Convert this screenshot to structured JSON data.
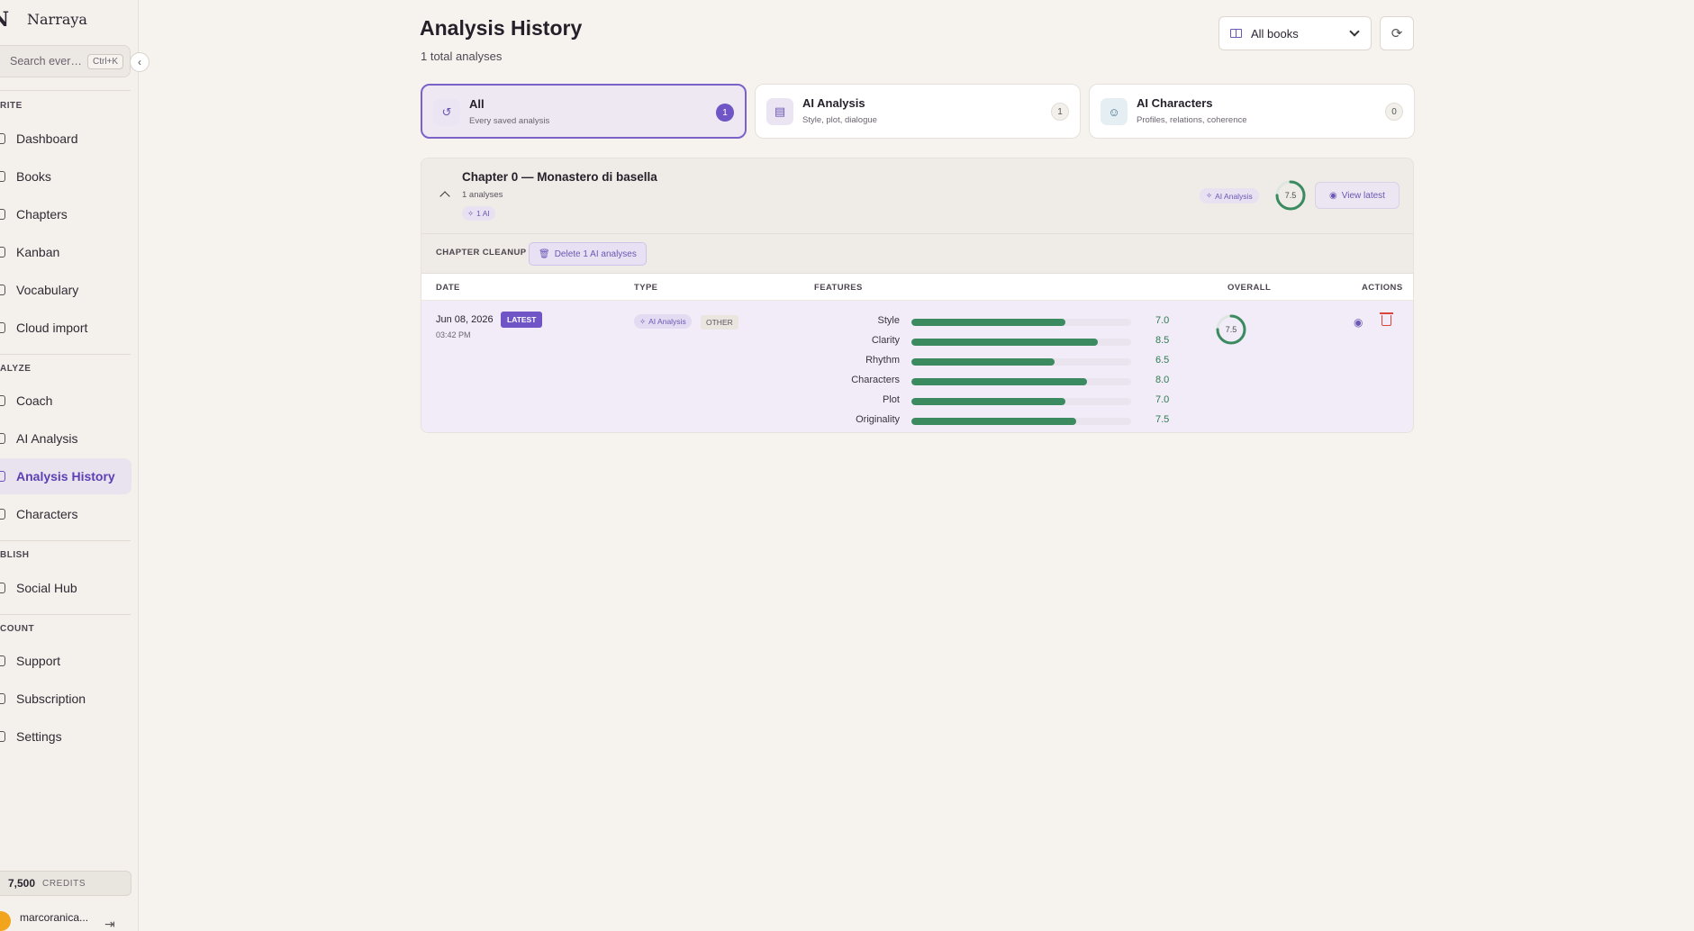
{
  "sidebar": {
    "brand": "Narraya",
    "brand_mark": "N",
    "search_placeholder": "Search ever…",
    "search_shortcut": "Ctrl+K",
    "sections": {
      "write": "RITE",
      "analyze": "ALYZE",
      "publish": "BLISH",
      "account": "COUNT"
    },
    "items": {
      "dashboard": "Dashboard",
      "books": "Books",
      "chapters": "Chapters",
      "kanban": "Kanban",
      "vocabulary": "Vocabulary",
      "cloud_import": "Cloud import",
      "coach": "Coach",
      "ai_analysis": "AI Analysis",
      "analysis_history": "Analysis History",
      "characters": "Characters",
      "social_hub": "Social Hub",
      "support": "Support",
      "subscription": "Subscription",
      "settings": "Settings"
    },
    "credits_value": "7,500",
    "credits_label": "CREDITS",
    "user_name": "marcoranica..."
  },
  "header": {
    "title": "Analysis History",
    "subtitle": "1 total analyses",
    "book_filter": "All books"
  },
  "filters": [
    {
      "title": "All",
      "desc": "Every saved analysis",
      "count": "1"
    },
    {
      "title": "AI Analysis",
      "desc": "Style, plot, dialogue",
      "count": "1"
    },
    {
      "title": "AI Characters",
      "desc": "Profiles, relations, coherence",
      "count": "0"
    }
  ],
  "group": {
    "title": "Chapter 0 — Monastero di basella",
    "count": "1 analyses",
    "ai_pill": "1 AI",
    "type_badge": "AI Analysis",
    "score": "7.5",
    "view_latest": "View latest",
    "cleanup_label": "CHAPTER CLEANUP",
    "delete_label": "Delete 1 AI analyses"
  },
  "table": {
    "headers": {
      "date": "DATE",
      "type": "TYPE",
      "features": "FEATURES",
      "overall": "OVERALL",
      "actions": "ACTIONS"
    },
    "row": {
      "date": "Jun 08, 2026",
      "latest_tag": "LATEST",
      "time": "03:42 PM",
      "type_badge": "AI Analysis",
      "type_other": "OTHER",
      "overall": "7.5",
      "overall_value": 7.5,
      "features": [
        {
          "label": "Style",
          "value": 7.0,
          "display": "7.0"
        },
        {
          "label": "Clarity",
          "value": 8.5,
          "display": "8.5"
        },
        {
          "label": "Rhythm",
          "value": 6.5,
          "display": "6.5"
        },
        {
          "label": "Characters",
          "value": 8.0,
          "display": "8.0"
        },
        {
          "label": "Plot",
          "value": 7.0,
          "display": "7.0"
        },
        {
          "label": "Originality",
          "value": 7.5,
          "display": "7.5"
        }
      ],
      "scale_max": 10
    }
  },
  "colors": {
    "accent": "#6f55c6",
    "bar": "#3b8a60",
    "danger": "#d9453c"
  }
}
